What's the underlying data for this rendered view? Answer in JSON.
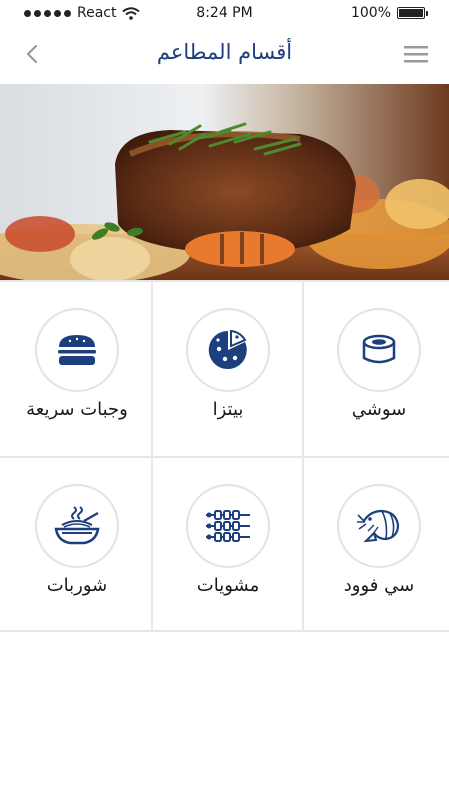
{
  "status": {
    "carrier": "React",
    "time": "8:24 PM",
    "battery": "100%",
    "battery_level": 1.0
  },
  "header": {
    "title": "أقسام المطاعم",
    "back_icon": "chevron-left-icon",
    "menu_icon": "hamburger-menu-icon"
  },
  "hero": {
    "image": "grilled-meat-with-vegetables"
  },
  "categories": [
    {
      "label": "سوشي",
      "icon": "sushi-icon"
    },
    {
      "label": "بيتزا",
      "icon": "pizza-icon"
    },
    {
      "label": "وجبات سريعة",
      "icon": "burger-icon"
    },
    {
      "label": "سي فوود",
      "icon": "shrimp-icon"
    },
    {
      "label": "مشويات",
      "icon": "skewers-icon"
    },
    {
      "label": "شوربات",
      "icon": "soup-bowl-icon"
    }
  ],
  "colors": {
    "accent": "#1d3f7d",
    "divider": "#e6e6e6"
  }
}
